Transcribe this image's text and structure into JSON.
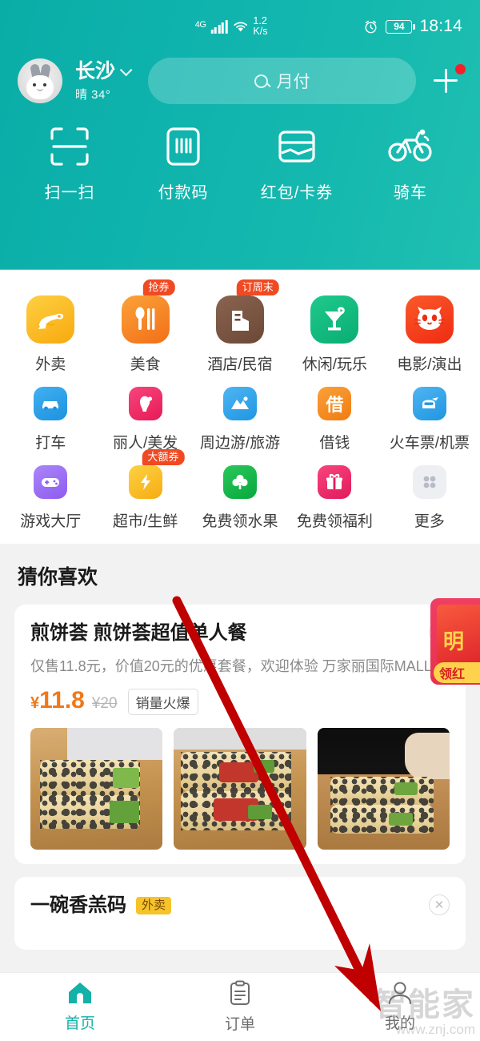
{
  "statusbar": {
    "network_type": "4G",
    "data_speed": "1.2",
    "data_speed_unit": "K/s",
    "alarm_icon": "alarm-clock-icon",
    "battery_level": "94",
    "time": "18:14"
  },
  "header": {
    "avatar": "rabbit-avatar",
    "city": "长沙",
    "weather": "晴 34°",
    "search_placeholder": "月付",
    "plus_label": "+",
    "has_notification_dot": true,
    "accent_color": "#12b2a8",
    "quick_actions": [
      {
        "label": "扫一扫",
        "icon": "scan-icon"
      },
      {
        "label": "付款码",
        "icon": "payment-code-icon"
      },
      {
        "label": "红包/卡券",
        "icon": "wallet-coupon-icon"
      },
      {
        "label": "骑车",
        "icon": "bike-icon"
      }
    ]
  },
  "grid": {
    "row1": [
      {
        "label": "外卖",
        "icon": "takeout-icon",
        "color": "#f9bd20",
        "badge": ""
      },
      {
        "label": "美食",
        "icon": "food-icon",
        "color": "#f58220",
        "badge": "抢券"
      },
      {
        "label": "酒店/民宿",
        "icon": "hotel-icon",
        "color": "#74523f",
        "badge": "订周末"
      },
      {
        "label": "休闲/玩乐",
        "icon": "leisure-icon",
        "color": "#12b77f",
        "badge": ""
      },
      {
        "label": "电影/演出",
        "icon": "movie-cat-icon",
        "color": "#f5401f",
        "badge": ""
      }
    ],
    "row2": [
      {
        "label": "打车",
        "icon": "taxi-icon",
        "color": "#2e9fe8",
        "badge": ""
      },
      {
        "label": "丽人/美发",
        "icon": "beauty-icon",
        "color": "#ef2e63",
        "badge": ""
      },
      {
        "label": "周边游/旅游",
        "icon": "travel-icon",
        "color": "#39a5e8",
        "badge": ""
      },
      {
        "label": "借钱",
        "icon": "loan-icon",
        "color": "#f68b1f",
        "badge": "",
        "glyph": "借"
      },
      {
        "label": "火车票/机票",
        "icon": "train-plane-icon",
        "color": "#3aa5e8",
        "badge": ""
      }
    ],
    "row3": [
      {
        "label": "游戏大厅",
        "icon": "game-icon",
        "color": "#9b6ef3",
        "badge": ""
      },
      {
        "label": "超市/生鲜",
        "icon": "supermarket-icon",
        "color": "#f9bd20",
        "badge": "大额券"
      },
      {
        "label": "免费领水果",
        "icon": "fruit-tree-icon",
        "color": "#14b24a",
        "badge": ""
      },
      {
        "label": "免费领福利",
        "icon": "gift-icon",
        "color": "#ed2f6a",
        "badge": ""
      },
      {
        "label": "更多",
        "icon": "more-grid-icon",
        "color": "#eceef2",
        "badge": ""
      }
    ]
  },
  "recommend": {
    "section_title": "猜你喜欢",
    "cards": [
      {
        "title": "煎饼荟 煎饼荟超值单人餐",
        "tag": "",
        "subtitle": "仅售11.8元，价值20元的优惠套餐，欢迎体验 万家丽国际MALL",
        "price_symbol": "¥",
        "price": "11.8",
        "price_old": "¥20",
        "sales_tag": "销量火爆",
        "close_icon": "close-icon",
        "thumbs": [
          "pancake-cucumber-photo",
          "pancake-bacon-photo",
          "pancake-dark-photo"
        ]
      },
      {
        "title": "一碗香羔码",
        "tag": "外卖",
        "subtitle": "",
        "close_icon": "close-icon"
      }
    ]
  },
  "floating": {
    "red_packet_char": "明",
    "red_packet_button": "领红"
  },
  "bottomnav": {
    "items": [
      {
        "label": "首页",
        "icon": "home-icon",
        "active": true
      },
      {
        "label": "订单",
        "icon": "order-list-icon",
        "active": false
      },
      {
        "label": "我的",
        "icon": "profile-person-icon",
        "active": false
      }
    ],
    "active_color": "#12b2a8"
  },
  "watermark": {
    "text": "智能家",
    "url": "www.znj.com"
  },
  "annotation": {
    "color": "#c00000",
    "type": "arrow-pointing-to-profile-tab"
  }
}
